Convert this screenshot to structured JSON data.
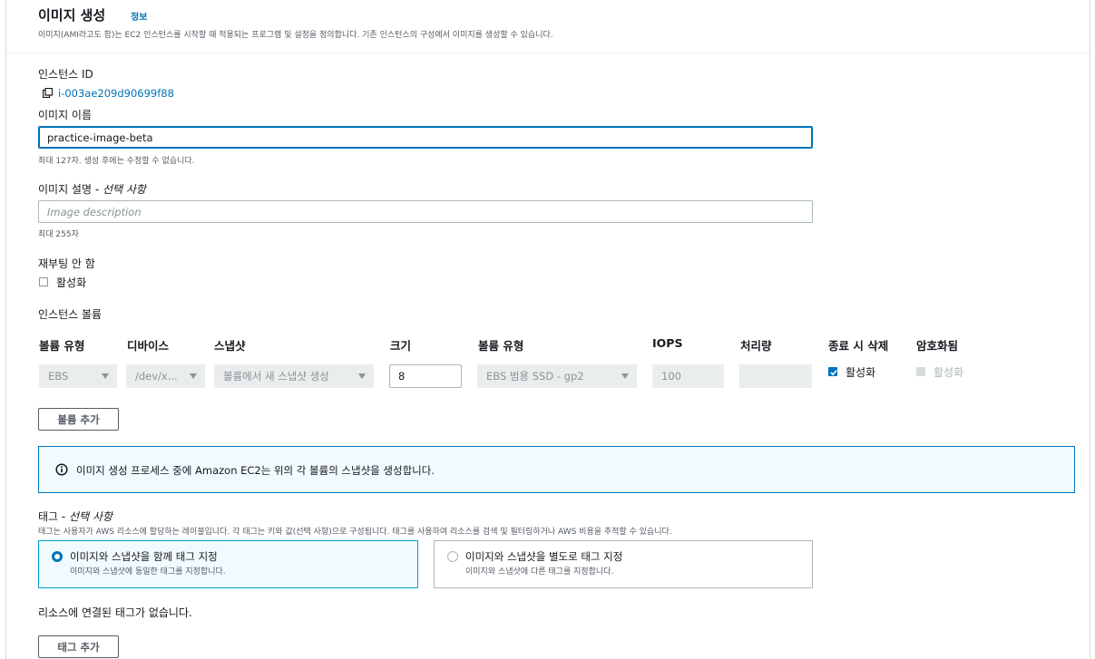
{
  "header": {
    "title": "이미지 생성",
    "info_link": "정보",
    "description": "이미지(AMI라고도 함)는 EC2 인스턴스를 시작할 때 적용되는 프로그램 및 설정을 정의합니다. 기존 인스턴스의 구성에서 이미지를 생성할 수 있습니다."
  },
  "instance": {
    "label": "인스턴스 ID",
    "id": "i-003ae209d90699f88"
  },
  "image_name": {
    "label": "이미지 이름",
    "value": "practice-image-beta",
    "hint": "최대 127자. 생성 후에는 수정할 수 없습니다."
  },
  "image_description": {
    "label": "이미지 설명 - ",
    "optional": "선택 사항",
    "placeholder": "Image description",
    "hint": "최대 255자"
  },
  "no_reboot": {
    "label": "재부팅 안 함",
    "checkbox_label": "활성화",
    "checked": false
  },
  "volumes": {
    "section_label": "인스턴스 볼륨",
    "columns": [
      "볼륨 유형",
      "디바이스",
      "스냅샷",
      "크기",
      "볼륨 유형",
      "IOPS",
      "처리량",
      "종료 시 삭제",
      "암호화됨"
    ],
    "row": {
      "volume_type": "EBS",
      "device": "/dev/x...",
      "snapshot": "볼륨에서 새 스냅샷 생성",
      "size": "8",
      "ebs_type": "EBS 범용 SSD - gp2",
      "iops": "100",
      "throughput": "",
      "delete_on_termination": "활성화",
      "delete_on_termination_checked": true,
      "encrypted": "활성화",
      "encrypted_checked": false
    },
    "add_button": "볼륨 추가"
  },
  "alert": {
    "text": "이미지 생성 프로세스 중에 Amazon EC2는 위의 각 볼륨의 스냅샷을 생성합니다."
  },
  "tags": {
    "label": "태그 - ",
    "optional": "선택 사항",
    "description": "태그는 사용자가 AWS 리소스에 할당하는 레이블입니다. 각 태그는 키와 값(선택 사항)으로 구성됩니다. 태그를 사용하여 리소스를 검색 및 필터링하거나 AWS 비용을 추적할 수 있습니다.",
    "options": [
      {
        "title": "이미지와 스냅샷을 함께 태그 지정",
        "desc": "이미지와 스냅샷에 동일한 태그를 지정합니다.",
        "selected": true
      },
      {
        "title": "이미지와 스냅샷을 별도로 태그 지정",
        "desc": "이미지와 스냅샷에 다른 태그를 지정합니다.",
        "selected": false
      }
    ],
    "empty_text": "리소스에 연결된 태그가 없습니다.",
    "add_button": "태그 추가"
  },
  "colors": {
    "link": "#0073bb",
    "focus_border": "#0073bb",
    "alert_bg": "#f1faff",
    "selected_tile_border": "#00a1c9"
  }
}
